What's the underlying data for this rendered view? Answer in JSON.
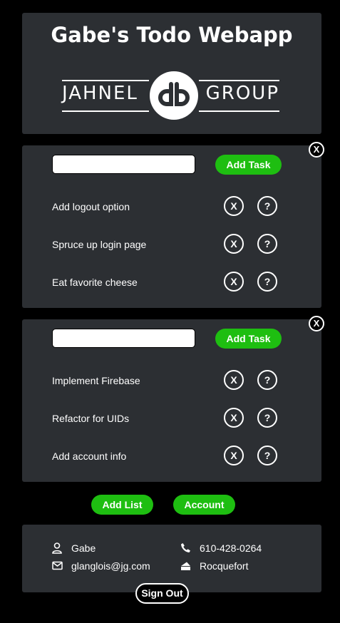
{
  "header": {
    "title": "Gabe's Todo Webapp",
    "logo_left": "JAHNEL",
    "logo_right": "GROUP"
  },
  "lists": [
    {
      "input_value": "",
      "add_task_label": "Add Task",
      "close_label": "X",
      "tasks": [
        {
          "label": "Add logout option",
          "delete_label": "X",
          "help_label": "?"
        },
        {
          "label": "Spruce up login page",
          "delete_label": "X",
          "help_label": "?"
        },
        {
          "label": "Eat favorite cheese",
          "delete_label": "X",
          "help_label": "?"
        }
      ]
    },
    {
      "input_value": "",
      "add_task_label": "Add Task",
      "close_label": "X",
      "tasks": [
        {
          "label": "Implement Firebase",
          "delete_label": "X",
          "help_label": "?"
        },
        {
          "label": "Refactor for UIDs",
          "delete_label": "X",
          "help_label": "?"
        },
        {
          "label": "Add account info",
          "delete_label": "X",
          "help_label": "?"
        }
      ]
    }
  ],
  "actions": {
    "add_list_label": "Add List",
    "account_label": "Account"
  },
  "footer": {
    "name": "Gabe",
    "email": "glanglois@jg.com",
    "phone": "610-428-0264",
    "favorite_cheese": "Rocquefort",
    "icons": {
      "name": "user-icon",
      "email": "envelope-icon",
      "phone": "phone-icon",
      "cheese": "cheese-icon"
    }
  },
  "sign_out_label": "Sign Out",
  "colors": {
    "background": "#000000",
    "card": "#2c2f33",
    "accent_green": "#1ebe11",
    "text": "#ffffff"
  }
}
